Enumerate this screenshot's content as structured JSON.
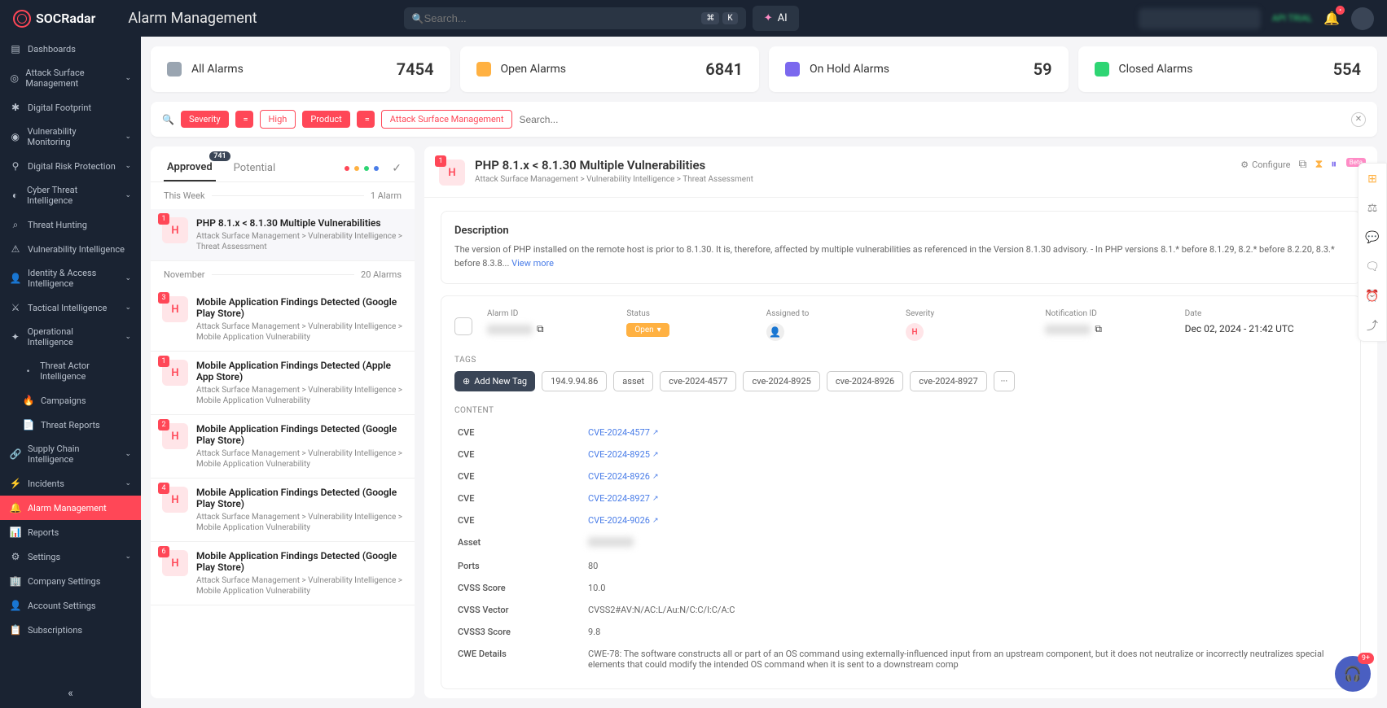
{
  "brand": "SOCRadar",
  "page_title": "Alarm Management",
  "search": {
    "placeholder": "Search...",
    "kbd1": "⌘",
    "kbd2": "K",
    "ai": "AI"
  },
  "topbar": {
    "trial": "API TRIAL",
    "bell_badge": "•"
  },
  "sidebar": {
    "items": [
      {
        "icon": "▤",
        "label": "Dashboards"
      },
      {
        "icon": "◎",
        "label": "Attack Surface Management",
        "chev": true
      },
      {
        "icon": "✱",
        "label": "Digital Footprint"
      },
      {
        "icon": "◉",
        "label": "Vulnerability Monitoring",
        "chev": true
      },
      {
        "icon": "⚲",
        "label": "Digital Risk Protection",
        "chev": true
      },
      {
        "icon": "◐",
        "label": "Cyber Threat Intelligence",
        "chev": true
      },
      {
        "icon": "⌕",
        "label": "Threat Hunting"
      },
      {
        "icon": "⚠",
        "label": "Vulnerability Intelligence"
      },
      {
        "icon": "👤",
        "label": "Identity & Access Intelligence",
        "chev": true
      },
      {
        "icon": "⚔",
        "label": "Tactical Intelligence",
        "chev": true
      },
      {
        "icon": "✦",
        "label": "Operational Intelligence",
        "chev": true
      },
      {
        "icon": "•",
        "label": "Threat Actor Intelligence",
        "sub": true
      },
      {
        "icon": "🔥",
        "label": "Campaigns",
        "sub": true
      },
      {
        "icon": "📄",
        "label": "Threat Reports",
        "sub": true
      },
      {
        "icon": "🔗",
        "label": "Supply Chain Intelligence",
        "chev": true
      },
      {
        "icon": "⚡",
        "label": "Incidents",
        "chev": true
      },
      {
        "icon": "🔔",
        "label": "Alarm Management",
        "active": true
      },
      {
        "icon": "📊",
        "label": "Reports"
      },
      {
        "icon": "⚙",
        "label": "Settings",
        "chev": true
      },
      {
        "icon": "🏢",
        "label": "Company Settings"
      },
      {
        "icon": "👤",
        "label": "Account Settings"
      },
      {
        "icon": "📋",
        "label": "Subscriptions"
      }
    ],
    "collapse": "«"
  },
  "stats": [
    {
      "color": "#9aa5b1",
      "label": "All Alarms",
      "value": "7454"
    },
    {
      "color": "#ffb142",
      "label": "Open Alarms",
      "value": "6841"
    },
    {
      "color": "#7b68ee",
      "label": "On Hold Alarms",
      "value": "59"
    },
    {
      "color": "#2ed573",
      "label": "Closed Alarms",
      "value": "554"
    }
  ],
  "filters": {
    "severity": "Severity",
    "eq": "=",
    "high": "High",
    "product": "Product",
    "asm": "Attack Surface Management",
    "search_ph": "Search..."
  },
  "list": {
    "tabs": {
      "approved": "Approved",
      "approved_badge": "741",
      "potential": "Potential"
    },
    "dots": [
      "#ff4757",
      "#ffb142",
      "#2ed573",
      "#4a7de8"
    ],
    "sections": [
      {
        "label": "This Week",
        "count": "1 Alarm"
      },
      {
        "label": "November",
        "count": "20 Alarms"
      }
    ],
    "items": [
      {
        "cnt": "1",
        "sev": "H",
        "title": "PHP 8.1.x < 8.1.30 Multiple Vulnerabilities",
        "bc": "Attack Surface Management > Vulnerability Intelligence > Threat Assessment",
        "selected": true,
        "section": 0
      },
      {
        "cnt": "3",
        "sev": "H",
        "title": "Mobile Application Findings Detected (Google Play Store)",
        "bc": "Attack Surface Management > Vulnerability Intelligence > Mobile Application Vulnerability",
        "section": 1
      },
      {
        "cnt": "1",
        "sev": "H",
        "title": "Mobile Application Findings Detected (Apple App Store)",
        "bc": "Attack Surface Management > Vulnerability Intelligence > Mobile Application Vulnerability",
        "section": 1
      },
      {
        "cnt": "2",
        "sev": "H",
        "title": "Mobile Application Findings Detected (Google Play Store)",
        "bc": "Attack Surface Management > Vulnerability Intelligence > Mobile Application Vulnerability",
        "section": 1
      },
      {
        "cnt": "4",
        "sev": "H",
        "title": "Mobile Application Findings Detected (Google Play Store)",
        "bc": "Attack Surface Management > Vulnerability Intelligence > Mobile Application Vulnerability",
        "section": 1
      },
      {
        "cnt": "6",
        "sev": "H",
        "title": "Mobile Application Findings Detected (Google Play Store)",
        "bc": "Attack Surface Management > Vulnerability Intelligence > Mobile Application Vulnerability",
        "section": 1
      }
    ]
  },
  "detail": {
    "cnt": "1",
    "sev": "H",
    "title": "PHP 8.1.x < 8.1.30 Multiple Vulnerabilities",
    "bc": "Attack Surface Management > Vulnerability Intelligence > Threat Assessment",
    "configure": "Configure",
    "beta": "Beta",
    "desc_title": "Description",
    "desc": "The version of PHP installed on the remote host is prior to 8.1.30. It is, therefore, affected by multiple vulnerabilities as referenced in the Version 8.1.30 advisory. - In PHP versions 8.1.* before 8.1.29, 8.2.* before 8.2.20, 8.3.* before 8.3.8...",
    "view_more": "View more",
    "meta": {
      "alarm_id_lbl": "Alarm ID",
      "status_lbl": "Status",
      "status": "Open",
      "assigned_lbl": "Assigned to",
      "severity_lbl": "Severity",
      "notif_lbl": "Notification ID",
      "date_lbl": "Date",
      "date": "Dec 02, 2024 - 21:42 UTC"
    },
    "tags_lbl": "TAGS",
    "add_tag": "Add New Tag",
    "tags": [
      "194.9.94.86",
      "asset",
      "cve-2024-4577",
      "cve-2024-8925",
      "cve-2024-8926",
      "cve-2024-8927"
    ],
    "tags_more": "···",
    "content_lbl": "CONTENT",
    "kv": [
      {
        "k": "CVE",
        "v": "CVE-2024-4577",
        "link": true
      },
      {
        "k": "CVE",
        "v": "CVE-2024-8925",
        "link": true
      },
      {
        "k": "CVE",
        "v": "CVE-2024-8926",
        "link": true
      },
      {
        "k": "CVE",
        "v": "CVE-2024-8927",
        "link": true
      },
      {
        "k": "CVE",
        "v": "CVE-2024-9026",
        "link": true
      },
      {
        "k": "Asset",
        "v": "",
        "blur": true
      },
      {
        "k": "Ports",
        "v": "80"
      },
      {
        "k": "CVSS Score",
        "v": "10.0"
      },
      {
        "k": "CVSS Vector",
        "v": "CVSS2#AV:N/AC:L/Au:N/C:C/I:C/A:C"
      },
      {
        "k": "CVSS3 Score",
        "v": "9.8"
      },
      {
        "k": "CWE Details",
        "v": "CWE-78: The software constructs all or part of an OS command using externally-influenced input from an upstream component, but it does not neutralize or incorrectly neutralizes special elements that could modify the intended OS command when it is sent to a downstream comp"
      }
    ]
  },
  "fab": {
    "count": "9+"
  }
}
